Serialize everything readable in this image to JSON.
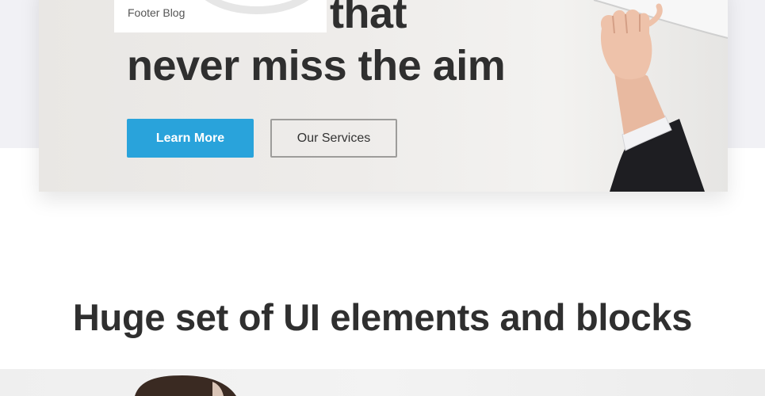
{
  "hero": {
    "title_line_1": "Solutions that",
    "title_line_2": "never miss the aim",
    "primary_button": "Learn More",
    "secondary_button": "Our Services"
  },
  "dropdown": {
    "items": [
      "Footer Blog"
    ]
  },
  "section": {
    "heading": "Huge set of UI elements and blocks"
  },
  "colors": {
    "accent": "#29a3db",
    "heading_text": "#2f2f2f",
    "page_band": "#f1f1f5"
  }
}
